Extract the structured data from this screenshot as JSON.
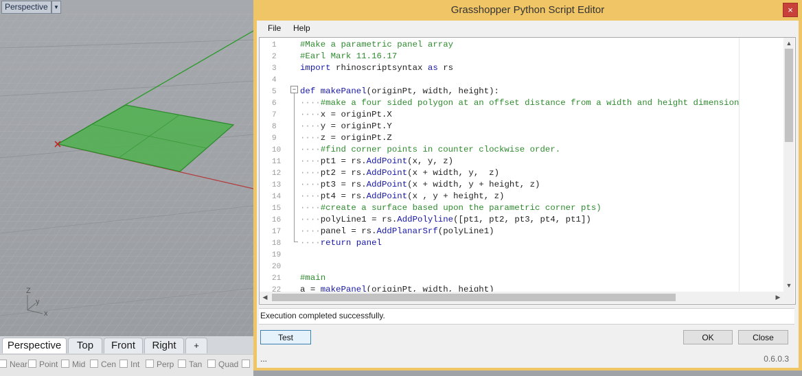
{
  "viewport": {
    "name": "Perspective",
    "dropdown_glyph": "▼",
    "axes": {
      "z": "Z",
      "y": "y",
      "x": "x"
    }
  },
  "viewport_tabs": [
    "Perspective",
    "Top",
    "Front",
    "Right"
  ],
  "add_tab_glyph": "+",
  "osnaps": [
    "Near",
    "Point",
    "Mid",
    "Cen",
    "Int",
    "Perp",
    "Tan",
    "Quad"
  ],
  "editor": {
    "title": "Grasshopper Python Script Editor",
    "close_glyph": "×",
    "menu": [
      "File",
      "Help"
    ],
    "line_numbers": [
      "1",
      "2",
      "3",
      "4",
      "5",
      "6",
      "7",
      "8",
      "9",
      "10",
      "11",
      "12",
      "13",
      "14",
      "15",
      "16",
      "17",
      "18",
      "19",
      "20",
      "21",
      "22"
    ],
    "code": {
      "l1": "#Make a parametric panel array",
      "l2": "#Earl Mark 11.16.17",
      "l3_kw": "import",
      "l3_mid": " rhinoscriptsyntax ",
      "l3_as": "as",
      "l3_end": " rs",
      "l5_def": "def",
      "l5_name": "makePanel",
      "l5_args": "(originPt, width, height):",
      "l6": "#make a four sided polygon at an offset distance from a width and height dimension",
      "l7": "x = originPt.X",
      "l8": "y = originPt.Y",
      "l9": "z = originPt.Z",
      "l10": "#find corner points in counter clockwise order.",
      "l11_a": "pt1 = rs.",
      "l11_fn": "AddPoint",
      "l11_b": "(x, y, z)",
      "l12_a": "pt2 = rs.",
      "l12_fn": "AddPoint",
      "l12_b": "(x + width, y,  z)",
      "l13_a": "pt3 = rs.",
      "l13_fn": "AddPoint",
      "l13_b": "(x + width, y + height, z)",
      "l14_a": "pt4 = rs.",
      "l14_fn": "AddPoint",
      "l14_b": "(x , y + height, z)",
      "l15": "#create a surface based upon the parametric corner pts)",
      "l16_a": "polyLine1 = rs.",
      "l16_fn": "AddPolyline",
      "l16_b": "([pt1, pt2, pt3, pt4, pt1])",
      "l17_a": "panel = rs.",
      "l17_fn": "AddPlanarSrf",
      "l17_b": "(polyLine1)",
      "l18": "return panel",
      "l21": "#main",
      "l22_a": "a = ",
      "l22_fn": "makePanel",
      "l22_b": "(originPt, width, height)"
    },
    "indent_dots": "····",
    "status": "Execution completed successfully.",
    "buttons": {
      "test": "Test",
      "ok": "OK",
      "close": "Close"
    },
    "footer_left": "...",
    "version": "0.6.0.3"
  }
}
